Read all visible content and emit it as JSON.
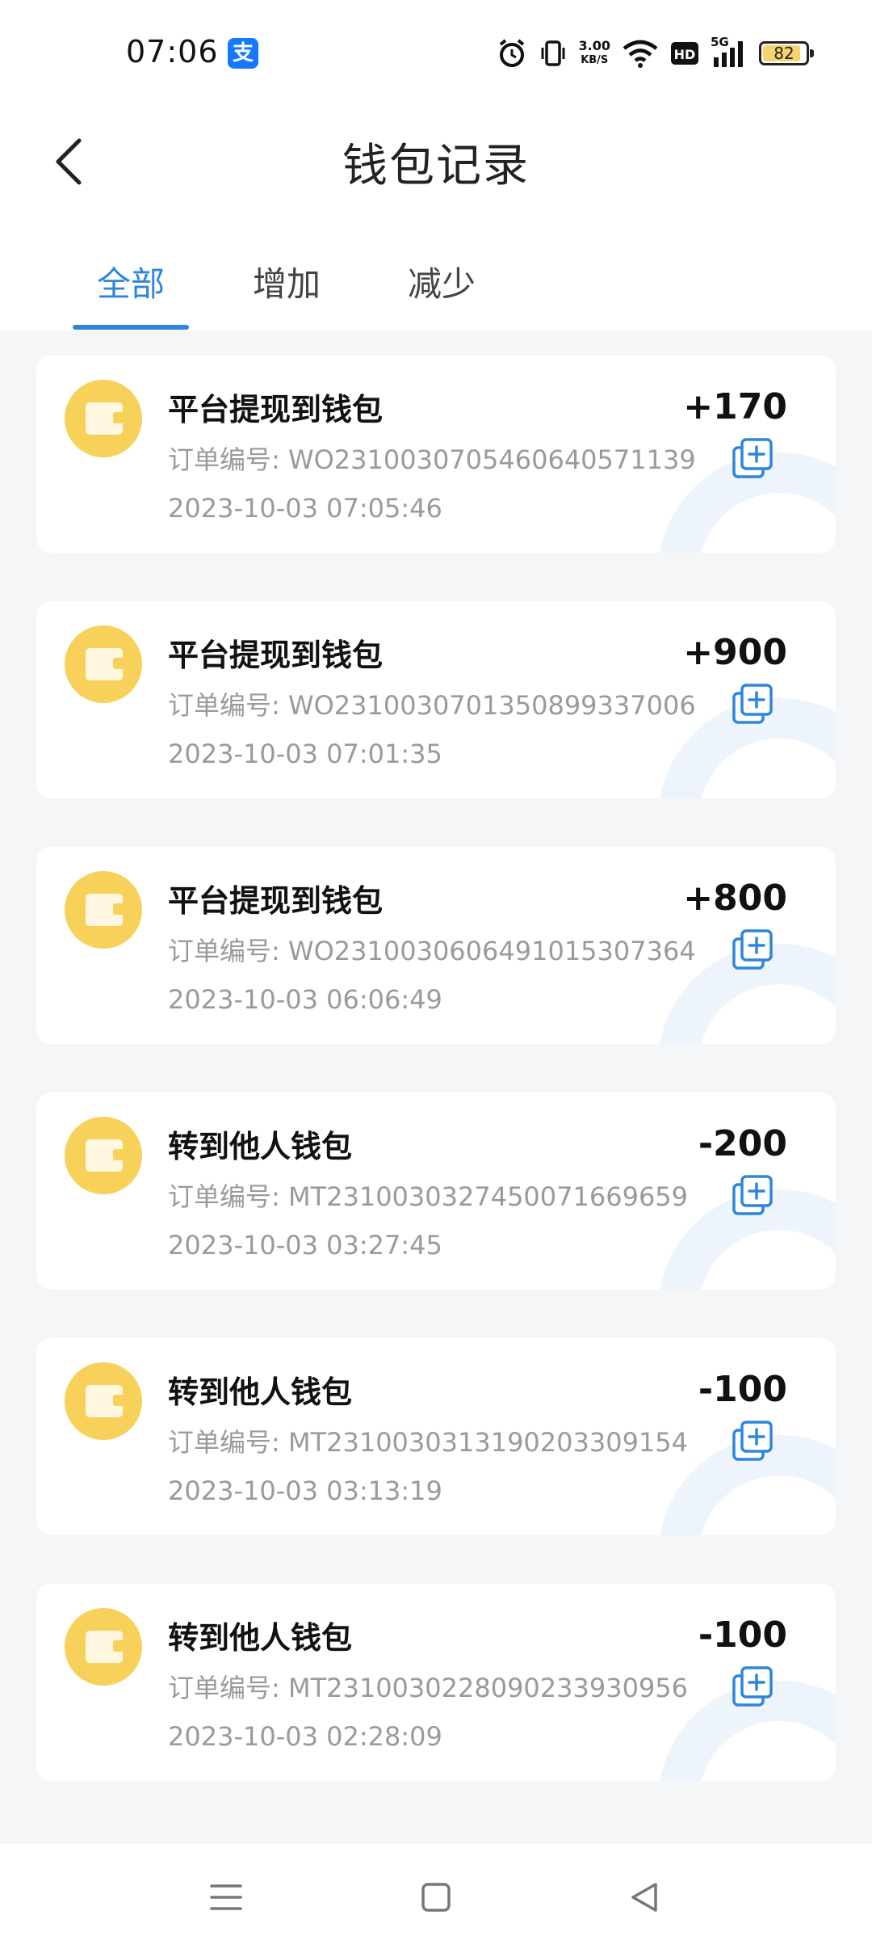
{
  "status_bar": {
    "time": "07:06",
    "network_speed_value": "3.00",
    "network_speed_unit": "KB/S",
    "signal_label": "5G",
    "battery": "82",
    "icons": [
      "alipay-icon",
      "alarm-icon",
      "vibrate-icon",
      "wifi-icon",
      "hd-icon",
      "signal-icon",
      "battery-icon"
    ]
  },
  "header": {
    "title": "钱包记录"
  },
  "tabs": [
    {
      "label": "全部",
      "active": true
    },
    {
      "label": "增加",
      "active": false
    },
    {
      "label": "减少",
      "active": false
    }
  ],
  "records": [
    {
      "title": "平台提现到钱包",
      "order": "订单编号: WO231003070546064057​1139",
      "time": "2023-10-03 07:05:46",
      "amount": "+170"
    },
    {
      "title": "平台提现到钱包",
      "order": "订单编号: WO231003070135089933​7006",
      "time": "2023-10-03 07:01:35",
      "amount": "+900"
    },
    {
      "title": "平台提现到钱包",
      "order": "订单编号: WO231003060649101530​7364",
      "time": "2023-10-03 06:06:49",
      "amount": "+800"
    },
    {
      "title": "转到他人钱包",
      "order": "订单编号: MT231003032745007166​9659",
      "time": "2023-10-03 03:27:45",
      "amount": "-200"
    },
    {
      "title": "转到他人钱包",
      "order": "订单编号: MT231003031319020330​9154",
      "time": "2023-10-03 03:13:19",
      "amount": "-100"
    },
    {
      "title": "转到他人钱包",
      "order": "订单编号: MT231003022809023393​0956",
      "time": "2023-10-03 02:28:09",
      "amount": "-100"
    }
  ],
  "colors": {
    "accent": "#2f86d9",
    "wallet_icon": "#f7d159",
    "background": "#f4f6f8"
  }
}
